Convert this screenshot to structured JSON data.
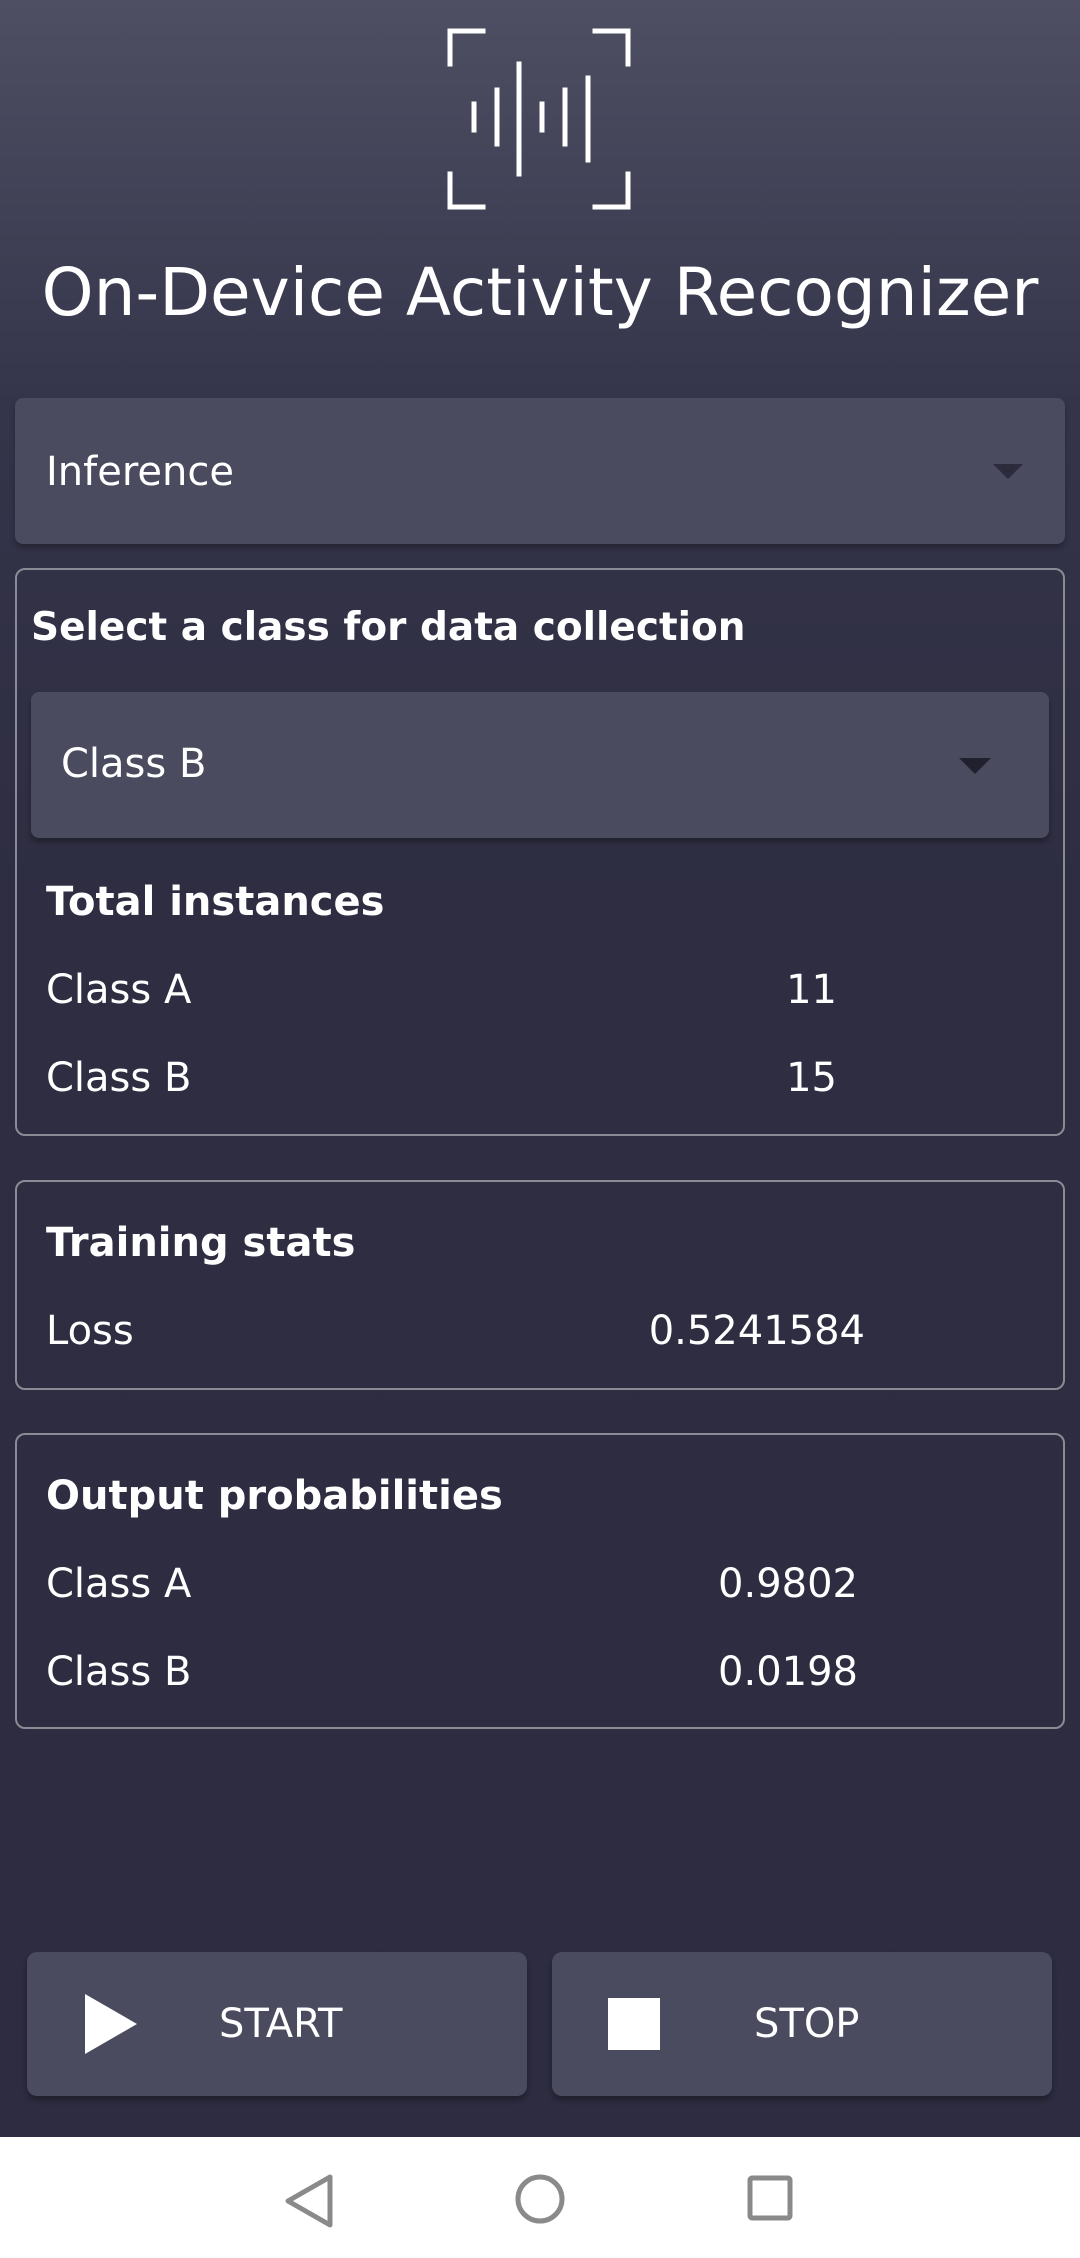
{
  "header": {
    "logo_icon": "audio-wave-frame-icon",
    "title": "On-Device Activity Recognizer"
  },
  "mode_select": {
    "value": "Inference",
    "icon": "dropdown-caret-icon"
  },
  "data_collection": {
    "heading": "Select a class for data collection",
    "class_select": {
      "value": "Class B",
      "icon": "dropdown-caret-icon"
    },
    "total_instances": {
      "heading": "Total instances",
      "rows": [
        {
          "label": "Class A",
          "value": "11"
        },
        {
          "label": "Class B",
          "value": "15"
        }
      ]
    }
  },
  "training_stats": {
    "heading": "Training stats",
    "rows": [
      {
        "label": "Loss",
        "value": "0.5241584"
      }
    ]
  },
  "output_probabilities": {
    "heading": "Output probabilities",
    "rows": [
      {
        "label": "Class A",
        "value": "0.9802"
      },
      {
        "label": "Class B",
        "value": "0.0198"
      }
    ]
  },
  "actions": {
    "start": {
      "label": "START",
      "icon": "play-icon"
    },
    "stop": {
      "label": "STOP",
      "icon": "stop-icon"
    }
  },
  "navbar": {
    "back_icon": "back-triangle-icon",
    "home_icon": "home-circle-icon",
    "recents_icon": "recents-square-icon"
  },
  "colors": {
    "background_top": "#4e4f63",
    "background_bottom": "#2d2c40",
    "control_surface": "#4a4b5e",
    "card_border": "#8b8b96",
    "text": "#ffffff",
    "navbar": "#ffffff"
  }
}
